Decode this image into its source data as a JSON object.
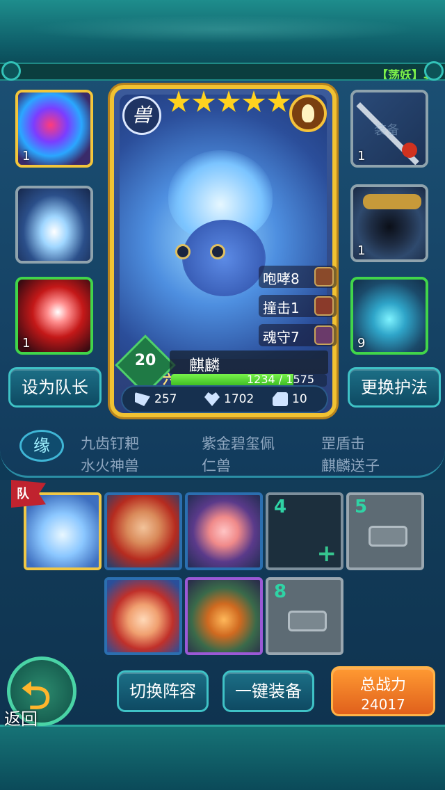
{
  "ticker": {
    "text": "【荡妖】真"
  },
  "card": {
    "stars": 5,
    "class_glyph": "兽",
    "level": "20",
    "rank_glyph": "六",
    "name": "麒麟",
    "exp_text": "1234 / 1575",
    "exp_current": 1234,
    "exp_max": 1575,
    "skills": [
      {
        "name": "咆哮8"
      },
      {
        "name": "撞击1"
      },
      {
        "name": "魂守7"
      }
    ],
    "stats": {
      "attack": "257",
      "hp": "1702",
      "defense": "10"
    }
  },
  "equipment": {
    "left": [
      {
        "count": "1",
        "item": "gem-orb"
      },
      {
        "count": "",
        "item": "lightning-charm"
      },
      {
        "count": "1",
        "item": "sword"
      }
    ],
    "right": [
      {
        "count": "1",
        "item": "spear",
        "faint_label": "装备"
      },
      {
        "count": "1",
        "item": "helmet"
      },
      {
        "count": "9",
        "item": "boots"
      }
    ]
  },
  "buttons": {
    "set_leader": "设为队长",
    "change_guardian": "更换护法",
    "switch_lineup": "切换阵容",
    "one_click_equip": "一键装备",
    "total_power_label": "总战力",
    "total_power_value": "24017",
    "back": "返回"
  },
  "fate": {
    "emblem": "缘",
    "items": [
      "九齿钉耙",
      "紫金碧玺佩",
      "罡盾击",
      "水火神兽",
      "仁兽",
      "麒麟送子"
    ]
  },
  "team": {
    "leader_flag": "队",
    "slots": [
      {
        "state": "hero",
        "label": ""
      },
      {
        "state": "hero",
        "label": ""
      },
      {
        "state": "hero",
        "label": ""
      },
      {
        "state": "empty",
        "label": "4"
      },
      {
        "state": "locked",
        "label": "5"
      },
      {
        "state": "hero",
        "label": ""
      },
      {
        "state": "hero",
        "label": ""
      },
      {
        "state": "locked",
        "label": "8"
      }
    ]
  },
  "colors": {
    "accent_teal": "#3fc2c6",
    "gold": "#f1c232",
    "exp_green": "#4ad22c",
    "ticker_green": "#7cf04a"
  }
}
